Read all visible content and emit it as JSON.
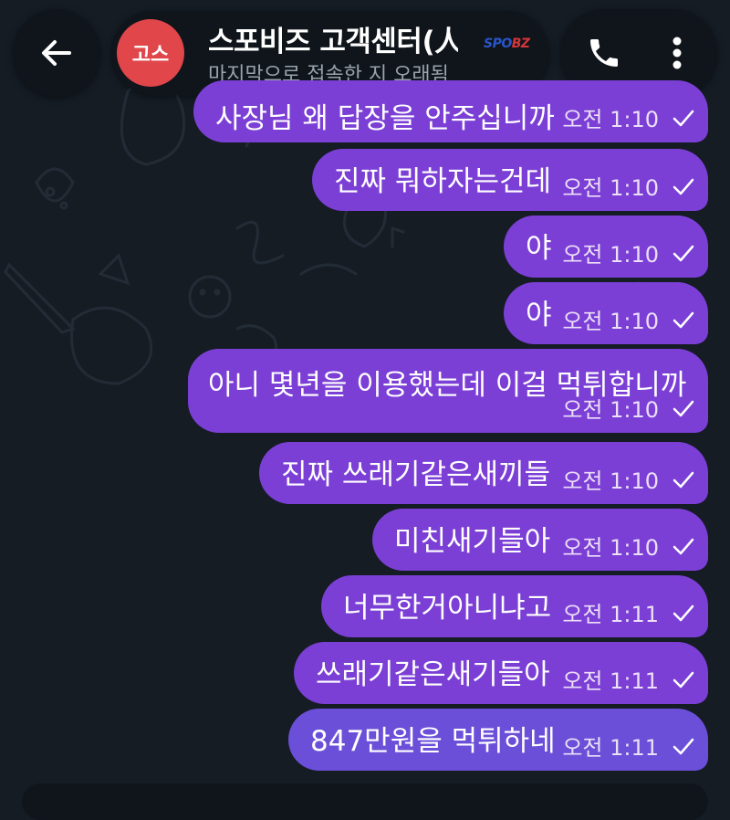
{
  "header": {
    "back_icon": "arrow-left-icon",
    "avatar_initials": "고스",
    "avatar_color": "#e0464a",
    "title": "스포비즈 고객센터(",
    "title_overflow": "人",
    "logo_text": "SPO",
    "logo_text_accent": "BZ",
    "status": "마지막으로 접속한 지 오래됨",
    "call_icon": "phone-icon",
    "menu_icon": "more-vertical-icon"
  },
  "colors": {
    "background": "#151c24",
    "bubble_outgoing": "#7b3fd6",
    "header_pill": "#0f151b"
  },
  "messages": [
    {
      "text": "사장님 왜 답장을 안주십니까",
      "time": "오전 1:10",
      "status_icon": "check-icon"
    },
    {
      "text": "진짜 뭐하자는건데",
      "time": "오전 1:10",
      "status_icon": "check-icon"
    },
    {
      "text": "야",
      "time": "오전 1:10",
      "status_icon": "check-icon"
    },
    {
      "text": "야",
      "time": "오전 1:10",
      "status_icon": "check-icon"
    },
    {
      "text": "아니 몇년을 이용했는데 이걸 먹튀합니까",
      "time": "오전 1:10",
      "status_icon": "check-icon"
    },
    {
      "text": "진짜 쓰래기같은새끼들",
      "time": "오전 1:10",
      "status_icon": "check-icon"
    },
    {
      "text": "미친새기들아",
      "time": "오전 1:10",
      "status_icon": "check-icon"
    },
    {
      "text": "너무한거아니냐고",
      "time": "오전 1:11",
      "status_icon": "check-icon"
    },
    {
      "text": "쓰래기같은새기들아",
      "time": "오전 1:11",
      "status_icon": "check-icon"
    },
    {
      "text": "847만원을 먹튀하네",
      "time": "오전 1:11",
      "status_icon": "check-icon"
    }
  ]
}
